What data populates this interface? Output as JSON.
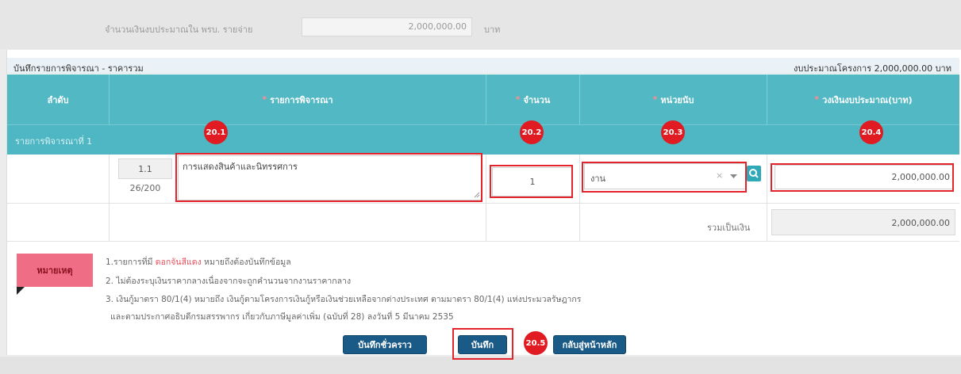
{
  "background": {
    "amount_label": "จำนวนเงินงบประมาณใน พรบ. รายจ่าย",
    "amount_value": "2,000,000.00",
    "amount_unit": "บาท"
  },
  "modal": {
    "title": "บันทึกรายการพิจารณา - ราคารวม",
    "budget_summary": "งบประมาณโครงการ 2,000,000.00 บาท"
  },
  "table": {
    "headers": {
      "seq": "ลำดับ",
      "item": "รายการพิจารณา",
      "qty": "จำนวน",
      "unit": "หน่วยนับ",
      "budget": "วงเงินงบประมาณ(บาท)"
    },
    "group_label": "รายการพิจารณาที่ 1",
    "row": {
      "number": "1.1",
      "char_count": "26/200",
      "item_text": "การแสดงสินค้าและนิทรรศการ",
      "qty": "1",
      "unit": "งาน",
      "budget": "2,000,000.00"
    },
    "total_label": "รวมเป็นเงิน",
    "total_value": "2,000,000.00"
  },
  "annotations": {
    "a1": "20.1",
    "a2": "20.2",
    "a3": "20.3",
    "a4": "20.4",
    "a5": "20.5"
  },
  "notes": {
    "badge": "หมายเหตุ",
    "line1_pre": "1.รายการที่มี ",
    "line1_red": "ดอกจันสีแดง",
    "line1_post": " หมายถึงต้องบันทึกข้อมูล",
    "line2": "2. ไม่ต้องระบุเงินราคากลางเนื่องจากจะถูกคำนวนจากงานราคากลาง",
    "line3": "3. เงินกู้มาตรา 80/1(4) หมายถึง เงินกู้ตามโครงการเงินกู้หรือเงินช่วยเหลือจากต่างประเทศ ตามมาตรา 80/1(4) แห่งประมวลรัษฎากร",
    "line4": "และตามประกาศอธิบดีกรมสรรพากร เกี่ยวกับภาษีมูลค่าเพิ่ม (ฉบับที่ 28) ลงวันที่ 5 มีนาคม 2535"
  },
  "buttons": {
    "save_draft": "บันทึกชั่วคราว",
    "save": "บันทึก",
    "back": "กลับสู่หน้าหลัก"
  },
  "colors": {
    "header_teal": "#52b8c4",
    "button_blue": "#1a5a86",
    "annotation_red": "#e01b22",
    "note_pink": "#f06d86"
  },
  "icons": {
    "search": "search-icon",
    "clear": "clear-icon",
    "dropdown": "caret-down-icon",
    "resize": "resize-handle-icon"
  }
}
